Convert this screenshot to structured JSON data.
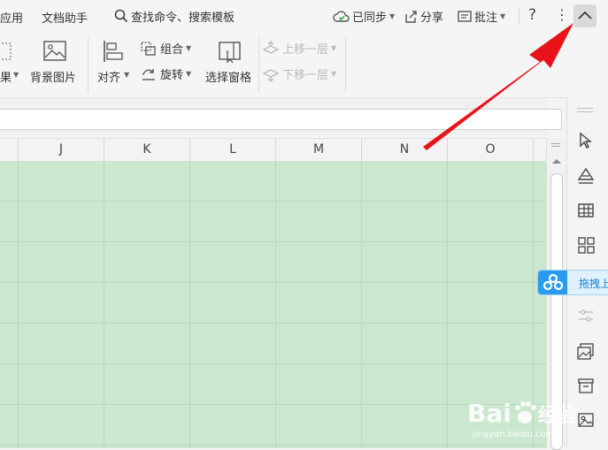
{
  "menubar": {
    "app_tab": "应用",
    "doc_assistant": "文档助手",
    "search_placeholder": "查找命令、搜索模板",
    "synced": "已同步",
    "share": "分享",
    "comment": "批注",
    "help": "?",
    "more": "⋮"
  },
  "toolbar": {
    "effect_partial": "果",
    "background_image": "背景图片",
    "align": "对齐",
    "group": "组合",
    "rotate": "旋转",
    "selection_pane": "选择窗格",
    "move_up": "上移一层",
    "move_down": "下移一层"
  },
  "columns": [
    "J",
    "K",
    "L",
    "M",
    "N",
    "O"
  ],
  "sidebar": {
    "baidu_label": "拖拽上传"
  },
  "watermark": {
    "brand": "Bai",
    "brand2": "经验",
    "url": "jingyan.baidu.com"
  },
  "colors": {
    "grid_fill": "#cbe8cf",
    "arrow_red": "#e8141a",
    "baidu_blue": "#2a9cf0"
  }
}
